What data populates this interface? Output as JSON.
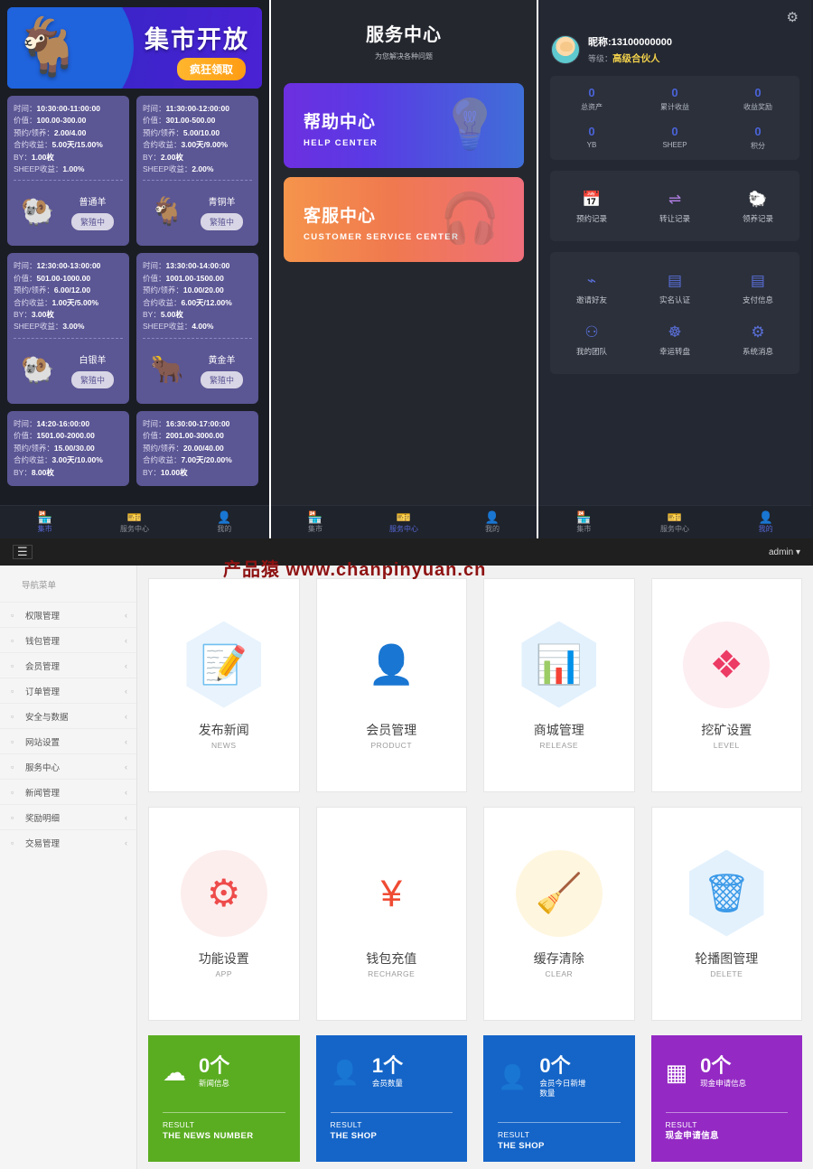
{
  "market": {
    "banner": {
      "title": "集市开放",
      "button": "疯狂领取",
      "icon": "goat-icon"
    },
    "labels": {
      "time": "时间：",
      "value": "价值：",
      "book": "预约/领养：",
      "yield": "合约收益：",
      "by": "BY：",
      "sheep": "SHEEP收益："
    },
    "cards": [
      {
        "time": "10:30:00-11:00:00",
        "value": "100.00-300.00",
        "book": "2.00/4.00",
        "yield": "5.00天/15.00%",
        "by": "1.00枚",
        "sheep": "1.00%",
        "name": "普通羊",
        "tag": "繁殖中",
        "emoji": "🐏"
      },
      {
        "time": "11:30:00-12:00:00",
        "value": "301.00-500.00",
        "book": "5.00/10.00",
        "yield": "3.00天/9.00%",
        "by": "2.00枚",
        "sheep": "2.00%",
        "name": "青铜羊",
        "tag": "繁殖中",
        "emoji": "🐐"
      },
      {
        "time": "12:30:00-13:00:00",
        "value": "501.00-1000.00",
        "book": "6.00/12.00",
        "yield": "1.00天/5.00%",
        "by": "3.00枚",
        "sheep": "3.00%",
        "name": "白银羊",
        "tag": "繁殖中",
        "emoji": "🐏"
      },
      {
        "time": "13:30:00-14:00:00",
        "value": "1001.00-1500.00",
        "book": "10.00/20.00",
        "yield": "6.00天/12.00%",
        "by": "5.00枚",
        "sheep": "4.00%",
        "name": "黄金羊",
        "tag": "繁殖中",
        "emoji": "🐂"
      },
      {
        "time": "14:20-16:00:00",
        "value": "1501.00-2000.00",
        "book": "15.00/30.00",
        "yield": "3.00天/10.00%",
        "by": "8.00枚",
        "sheep": "",
        "name": "",
        "tag": "",
        "emoji": ""
      },
      {
        "time": "16:30:00-17:00:00",
        "value": "2001.00-3000.00",
        "book": "20.00/40.00",
        "yield": "7.00天/20.00%",
        "by": "10.00枚",
        "sheep": "",
        "name": "",
        "tag": "",
        "emoji": ""
      }
    ],
    "tabs": [
      {
        "label": "集市",
        "icon": "shop-icon",
        "active": true
      },
      {
        "label": "服务中心",
        "icon": "badge-icon",
        "active": false
      },
      {
        "label": "我的",
        "icon": "user-icon",
        "active": false
      }
    ]
  },
  "service": {
    "title": "服务中心",
    "subtitle": "为您解决各种问题",
    "cards": [
      {
        "cn": "帮助中心",
        "en": "HELP CENTER",
        "icon": "bulb-icon"
      },
      {
        "cn": "客服中心",
        "en": "CUSTOMER SERVICE CENTER",
        "icon": "headset-icon"
      }
    ],
    "tabs": [
      {
        "label": "集市",
        "icon": "shop-icon",
        "active": false
      },
      {
        "label": "服务中心",
        "icon": "badge-icon",
        "active": true
      },
      {
        "label": "我的",
        "icon": "user-icon",
        "active": false
      }
    ]
  },
  "mine": {
    "gear_icon": "gear-icon",
    "nickname": "昵称:13100000000",
    "level_label": "等级：",
    "level_value": "高级合伙人",
    "stats": [
      {
        "value": "0",
        "label": "总资产"
      },
      {
        "value": "0",
        "label": "累计收益"
      },
      {
        "value": "0",
        "label": "收益奖励"
      },
      {
        "value": "0",
        "label": "YB"
      },
      {
        "value": "0",
        "label": "SHEEP"
      },
      {
        "value": "0",
        "label": "积分"
      }
    ],
    "records": [
      {
        "label": "预约记录",
        "glyph": "📅",
        "icon": "calendar-clock-icon"
      },
      {
        "label": "转让记录",
        "glyph": "⇌",
        "icon": "transfer-icon"
      },
      {
        "label": "领养记录",
        "glyph": "🐑",
        "icon": "sheep-icon"
      }
    ],
    "actions": [
      {
        "label": "邀请好友",
        "glyph": "⌁",
        "icon": "share-icon"
      },
      {
        "label": "实名认证",
        "glyph": "▤",
        "icon": "id-card-icon"
      },
      {
        "label": "支付信息",
        "glyph": "▤",
        "icon": "payment-card-icon"
      },
      {
        "label": "我的团队",
        "glyph": "⚇",
        "icon": "team-icon"
      },
      {
        "label": "幸运转盘",
        "glyph": "☸",
        "icon": "wheel-icon"
      },
      {
        "label": "系统消息",
        "glyph": "⚙",
        "icon": "gear-icon"
      }
    ],
    "tabs": [
      {
        "label": "集市",
        "icon": "shop-icon",
        "active": false
      },
      {
        "label": "服务中心",
        "icon": "badge-icon",
        "active": false
      },
      {
        "label": "我的",
        "icon": "user-icon",
        "active": true
      }
    ]
  },
  "admin": {
    "menu_icon": "hamburger-icon",
    "user": "admin ▾",
    "watermark": "产品猿  www.chanpinyuan.cn",
    "nav_title": "导航菜单",
    "nav": [
      {
        "label": "权限管理",
        "icon": "shield-icon"
      },
      {
        "label": "钱包管理",
        "icon": "wallet-icon"
      },
      {
        "label": "会员管理",
        "icon": "users-icon"
      },
      {
        "label": "订单管理",
        "icon": "order-icon"
      },
      {
        "label": "安全与数据",
        "icon": "monitor-icon"
      },
      {
        "label": "网站设置",
        "icon": "monitor-icon"
      },
      {
        "label": "服务中心",
        "icon": "monitor-icon"
      },
      {
        "label": "新闻管理",
        "icon": "news-icon"
      },
      {
        "label": "奖励明细",
        "icon": "grid-icon"
      },
      {
        "label": "交易管理",
        "icon": "circle-icon"
      }
    ],
    "nav_chevron": "‹",
    "tiles": [
      {
        "cn": "发布新闻",
        "en": "NEWS",
        "glyph": "📝",
        "icon": "document-edit-icon",
        "shape": "hex",
        "bg": "#e8f3fd",
        "color": "#3c9ae8"
      },
      {
        "cn": "会员管理",
        "en": "PRODUCT",
        "glyph": "👤",
        "icon": "user-verified-icon",
        "shape": "none",
        "bg": "transparent",
        "color": "#3fbf5f"
      },
      {
        "cn": "商城管理",
        "en": "RELEASE",
        "glyph": "📊",
        "icon": "chart-up-icon",
        "shape": "hex",
        "bg": "#e3f1fd",
        "color": "#3c9ae8"
      },
      {
        "cn": "挖矿设置",
        "en": "LEVEL",
        "glyph": "❖",
        "icon": "blocks-icon",
        "shape": "circle",
        "bg": "#fdeef2",
        "color": "#ec3b64"
      },
      {
        "cn": "功能设置",
        "en": "APP",
        "glyph": "⚙",
        "icon": "gear-icon",
        "shape": "circle",
        "bg": "#fdeeee",
        "color": "#ee4b4b"
      },
      {
        "cn": "钱包充值",
        "en": "RECHARGE",
        "glyph": "¥",
        "icon": "recharge-icon",
        "shape": "none",
        "bg": "transparent",
        "color": "#ef4b33"
      },
      {
        "cn": "缓存清除",
        "en": "CLEAR",
        "glyph": "🧹",
        "icon": "broom-icon",
        "shape": "circle",
        "bg": "#fff6e0",
        "color": "#f5b125"
      },
      {
        "cn": "轮播图管理",
        "en": "DELETE",
        "glyph": "🗑",
        "icon": "trash-icon",
        "shape": "hex",
        "bg": "#e3f1fd",
        "color": "#3c9ae8"
      }
    ],
    "stats": [
      {
        "value": "0个",
        "label": "新闻信息",
        "result": "RESULT",
        "sub": "THE NEWS NUMBER",
        "bg": "#5aad21",
        "glyph": "☁",
        "icon": "cloud-icon"
      },
      {
        "value": "1个",
        "label": "会员数量",
        "result": "RESULT",
        "sub": "THE SHOP",
        "bg": "#1565c8",
        "glyph": "👤",
        "icon": "user-icon"
      },
      {
        "value": "0个",
        "label": "会员今日新增数量",
        "result": "RESULT",
        "sub": "THE SHOP",
        "bg": "#1565c8",
        "glyph": "👤",
        "icon": "user-icon"
      },
      {
        "value": "0个",
        "label": "现金申请信息",
        "result": "RESULT",
        "sub": "现金申请信息",
        "bg": "#9429c4",
        "glyph": "▦",
        "icon": "calendar-icon"
      }
    ]
  }
}
